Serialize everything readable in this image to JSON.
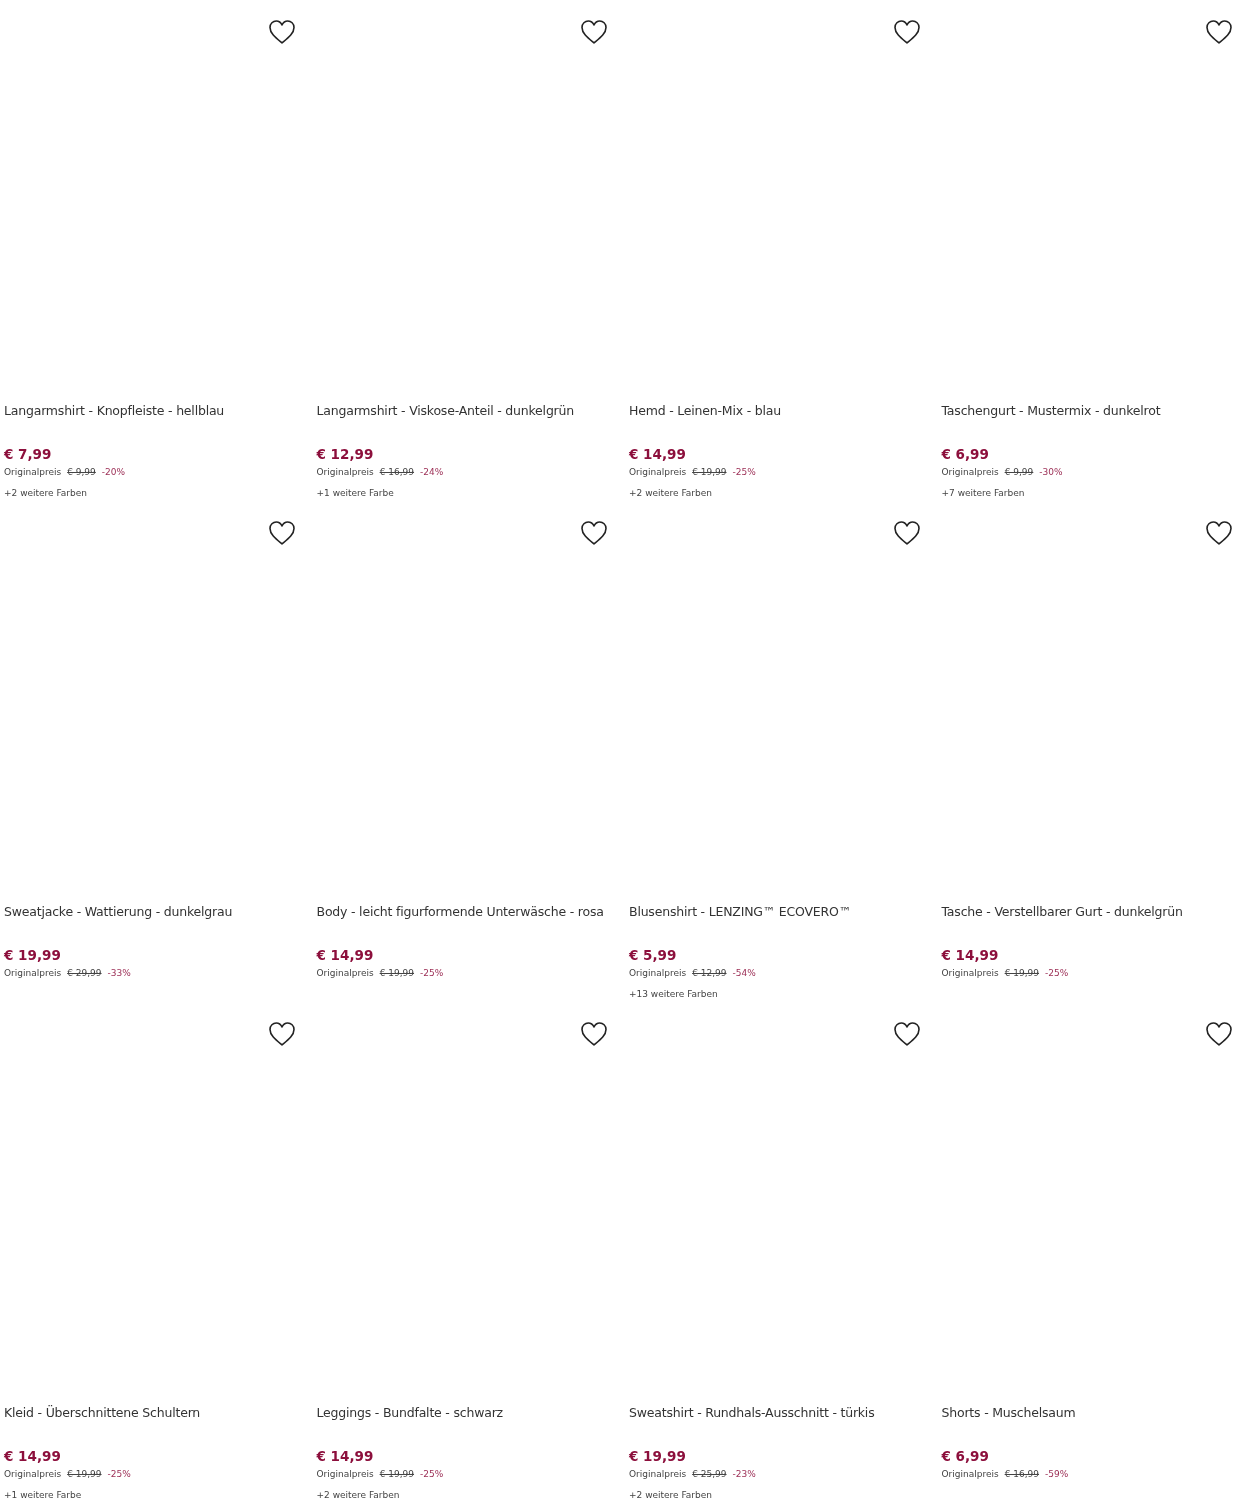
{
  "products": [
    {
      "title": "Langarmshirt - Knopfleiste - hellblau",
      "price": "€ 7,99",
      "original_label": "Originalpreis",
      "original_price": "€ 9,99",
      "discount": "-20%",
      "more_colors": "+2 weitere Farben"
    },
    {
      "title": "Langarmshirt - Viskose-Anteil - dunkelgrün",
      "price": "€ 12,99",
      "original_label": "Originalpreis",
      "original_price": "€ 16,99",
      "discount": "-24%",
      "more_colors": "+1 weitere Farbe"
    },
    {
      "title": "Hemd - Leinen-Mix - blau",
      "price": "€ 14,99",
      "original_label": "Originalpreis",
      "original_price": "€ 19,99",
      "discount": "-25%",
      "more_colors": "+2 weitere Farben"
    },
    {
      "title": "Taschengurt - Mustermix - dunkelrot",
      "price": "€ 6,99",
      "original_label": "Originalpreis",
      "original_price": "€ 9,99",
      "discount": "-30%",
      "more_colors": "+7 weitere Farben"
    },
    {
      "title": "Sweatjacke - Wattierung - dunkelgrau",
      "price": "€ 19,99",
      "original_label": "Originalpreis",
      "original_price": "€ 29,99",
      "discount": "-33%"
    },
    {
      "title": "Body - leicht figurformende Unterwäsche - rosa",
      "price": "€ 14,99",
      "original_label": "Originalpreis",
      "original_price": "€ 19,99",
      "discount": "-25%"
    },
    {
      "title": "Blusenshirt - LENZING™ ECOVERO™",
      "price": "€ 5,99",
      "original_label": "Originalpreis",
      "original_price": "€ 12,99",
      "discount": "-54%",
      "more_colors": "+13 weitere Farben"
    },
    {
      "title": "Tasche - Verstellbarer Gurt - dunkelgrün",
      "price": "€ 14,99",
      "original_label": "Originalpreis",
      "original_price": "€ 19,99",
      "discount": "-25%"
    },
    {
      "title": "Kleid - Überschnittene Schultern",
      "price": "€ 14,99",
      "original_label": "Originalpreis",
      "original_price": "€ 19,99",
      "discount": "-25%",
      "more_colors": "+1 weitere Farbe"
    },
    {
      "title": "Leggings - Bundfalte - schwarz",
      "price": "€ 14,99",
      "original_label": "Originalpreis",
      "original_price": "€ 19,99",
      "discount": "-25%",
      "more_colors": "+2 weitere Farben"
    },
    {
      "title": "Sweatshirt - Rundhals-Ausschnitt - türkis",
      "price": "€ 19,99",
      "original_label": "Originalpreis",
      "original_price": "€ 25,99",
      "discount": "-23%",
      "more_colors": "+2 weitere Farben"
    },
    {
      "title": "Shorts - Muschelsaum",
      "price": "€ 6,99",
      "original_label": "Originalpreis",
      "original_price": "€ 16,99",
      "discount": "-59%"
    }
  ]
}
